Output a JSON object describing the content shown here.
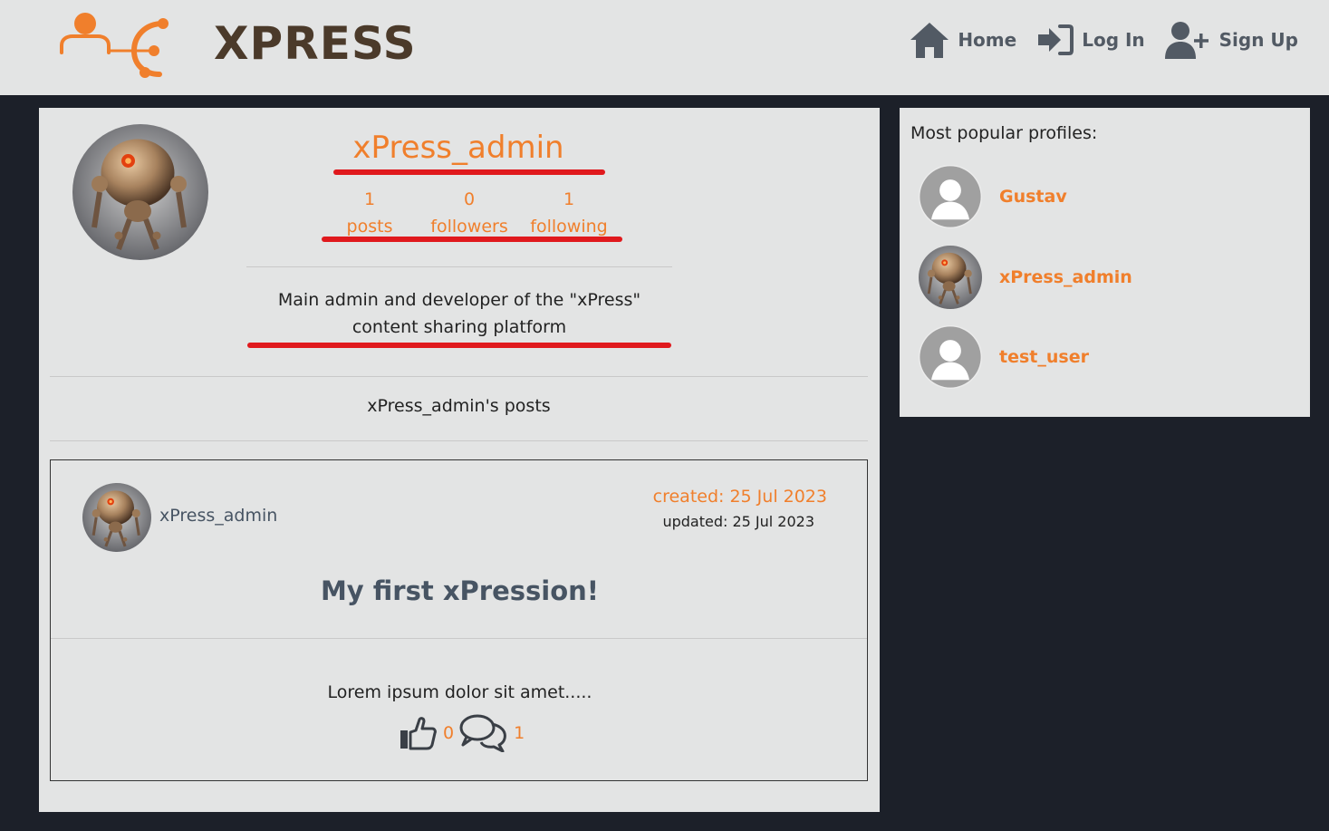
{
  "brand": {
    "logo_text": "XPRESS",
    "accent_color": "#f07f2c",
    "logo_dark_color": "#4b3a2a"
  },
  "nav": {
    "home_label": "Home",
    "login_label": "Log In",
    "signup_label": "Sign Up",
    "icons": [
      "home-icon",
      "log-in-icon",
      "user-plus-icon"
    ]
  },
  "profile": {
    "owner": "xPress_admin",
    "stats": [
      {
        "count": "1",
        "label": "posts"
      },
      {
        "count": "0",
        "label": "followers"
      },
      {
        "count": "1",
        "label": "following"
      }
    ],
    "bio_line1": "Main admin and developer of the \"xPress\"",
    "bio_line2": "content sharing platform",
    "posts_heading": "xPress_admin's posts",
    "highlight_color": "#e0191d"
  },
  "post": {
    "author": "xPress_admin",
    "created": "created: 25 Jul 2023",
    "updated": "updated: 25 Jul 2023",
    "title": "My first xPression!",
    "body": "Lorem ipsum dolor sit amet.....",
    "likes": "0",
    "comments": "1"
  },
  "popular": {
    "title": "Most popular profiles:",
    "items": [
      {
        "name": "Gustav",
        "avatar": "default-avatar"
      },
      {
        "name": "xPress_admin",
        "avatar": "robot-avatar"
      },
      {
        "name": "test_user",
        "avatar": "default-avatar"
      }
    ]
  },
  "colors": {
    "background": "#1c2029",
    "panel": "#e3e4e4",
    "text_muted": "#475463"
  }
}
